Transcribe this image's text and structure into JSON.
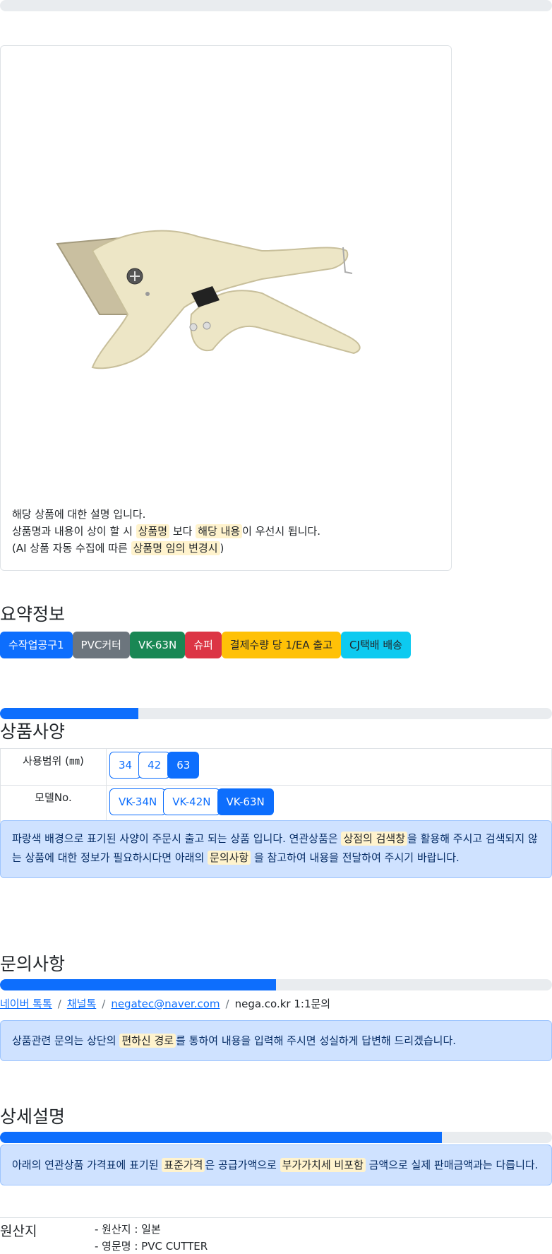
{
  "progress": {
    "top_fill": 0,
    "spec_fill": 0.25,
    "inquiry_fill": 0.5,
    "detail_fill": 0.8
  },
  "product": {
    "image_alt": "PVC pipe cutter",
    "description": [
      {
        "pre": "해당 상품에 대한 설명 입니다.",
        "mark": "",
        "post": ""
      },
      {
        "pre": "상품명과 내용이 상이 할 시 ",
        "mark": "상품명",
        "mid": " 보다 ",
        "mark2": "해당 내용",
        "post": "이 우선시 됩니다."
      },
      {
        "pre": "(AI 상품 자동 수집에 따른 ",
        "mark": "상품명 임의 변경시",
        "post": ")"
      }
    ]
  },
  "summary": {
    "title": "요약정보",
    "badges": [
      {
        "label": "수작업공구1",
        "color": "#0d6efd"
      },
      {
        "label": "PVC커터",
        "color": "#6c757d"
      },
      {
        "label": "VK-63N",
        "color": "#198754"
      },
      {
        "label": "슈퍼",
        "color": "#dc3545"
      },
      {
        "label": "결제수량 당 1/EA 출고",
        "color": "#ffc107"
      },
      {
        "label": "CJ택배 배송",
        "color": "#0dcaf0"
      }
    ]
  },
  "spec": {
    "title": "상품사양",
    "rows": [
      {
        "label": "사용범위 (㎜)",
        "options": [
          "34",
          "42",
          "63"
        ],
        "selected": "63"
      },
      {
        "label": "모델No.",
        "options": [
          "VK-34N",
          "VK-42N",
          "VK-63N"
        ],
        "selected": "VK-63N"
      }
    ],
    "notice": {
      "pre": "파랑색 배경으로 표기된 사양이 주문시 출고 되는 상품 입니다. 연관상품은 ",
      "mark1": "상점의 검색창",
      "mid1": "을 활용해 주시고 검색되지 않",
      "line2_pre": "는 상품에 대한 정보가 필요하시다면 아래의 ",
      "mark2": "문의사항",
      "post": " 을 참고하여 내용을 전달하여 주시기 바랍니다."
    }
  },
  "inquiry": {
    "title": "문의사항",
    "links": [
      "네이버 톡톡",
      "채널톡",
      "negatec@naver.com"
    ],
    "last": "nega.co.kr 1:1문의",
    "separator": "/",
    "notice": {
      "pre": "상품관련 문의는 상단의 ",
      "mark": "편하신 경로",
      "post": "를 통하여 내용을 입력해 주시면 성실하게 답변해 드리겠습니다."
    }
  },
  "detail": {
    "title": "상세설명",
    "notice": {
      "pre": "아래의 연관상품 가격표에 표기된 ",
      "mark1": "표준가격",
      "mid": "은 공급가액으로 ",
      "mark2": "부가가치세 비포함",
      "post": " 금액으로 실제 판매금액과는 다릅니다."
    }
  },
  "origin": {
    "label": "원산지",
    "items": [
      "- 원산지 : 일본",
      "- 영문명 : PVC CUTTER"
    ]
  }
}
